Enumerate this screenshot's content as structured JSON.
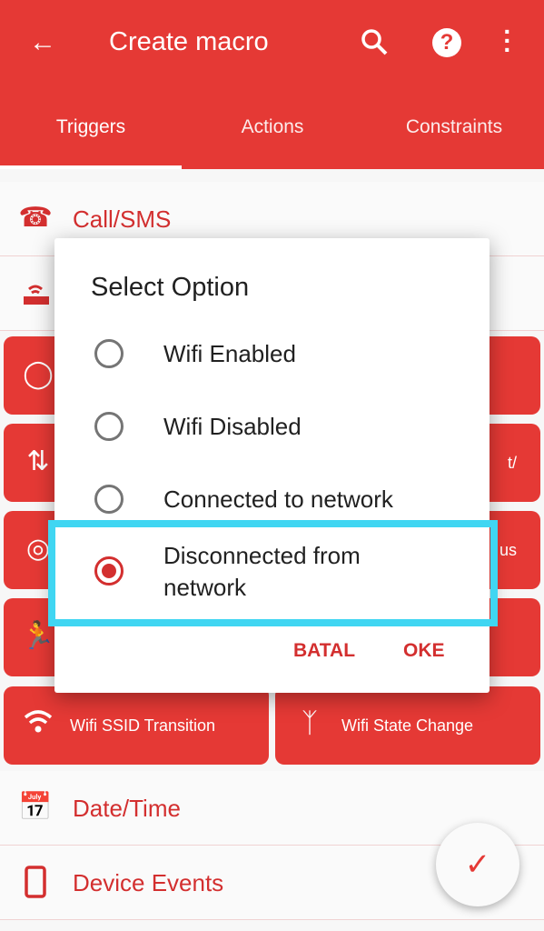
{
  "appbar": {
    "title": "Create macro",
    "icons": [
      "arrow-back-icon",
      "search-icon",
      "help-icon",
      "more-vert-icon"
    ]
  },
  "tabs": [
    {
      "label": "Triggers",
      "active": true
    },
    {
      "label": "Actions"
    },
    {
      "label": "Constraints"
    }
  ],
  "categories": [
    {
      "label": "Call/SMS",
      "icon": "phone-icon"
    },
    {
      "label": "",
      "icon": "router-icon"
    },
    {
      "label": "Date/Time",
      "icon": "calendar-clock-icon"
    },
    {
      "label": "Device Events",
      "icon": "phone-device-icon"
    }
  ],
  "cards": {
    "left": [
      {
        "icon": "watch-icon",
        "label": ""
      },
      {
        "icon": "data-transfer-icon",
        "label": ""
      },
      {
        "icon": "hotspot-icon",
        "label": ""
      },
      {
        "icon": "running-icon",
        "label": ""
      },
      {
        "icon": "wifi-icon",
        "label": "Wifi SSID Transition"
      }
    ],
    "right": [
      {
        "label": ""
      },
      {
        "label": "t/"
      },
      {
        "label": "us"
      },
      {
        "label": ""
      },
      {
        "icon": "wifi-antenna-icon",
        "label": "Wifi State Change"
      }
    ]
  },
  "dialog": {
    "title": "Select Option",
    "options": [
      {
        "label": "Wifi Enabled",
        "selected": false
      },
      {
        "label": "Wifi Disabled",
        "selected": false
      },
      {
        "label": "Connected to network",
        "selected": false
      },
      {
        "label": "Disconnected from network",
        "selected": true
      }
    ],
    "cancel": "BATAL",
    "ok": "OKE"
  },
  "fab": {
    "icon": "check-icon"
  },
  "colors": {
    "primary": "#e53935",
    "accent": "#d32f2f",
    "highlight": "#40d6f2"
  }
}
